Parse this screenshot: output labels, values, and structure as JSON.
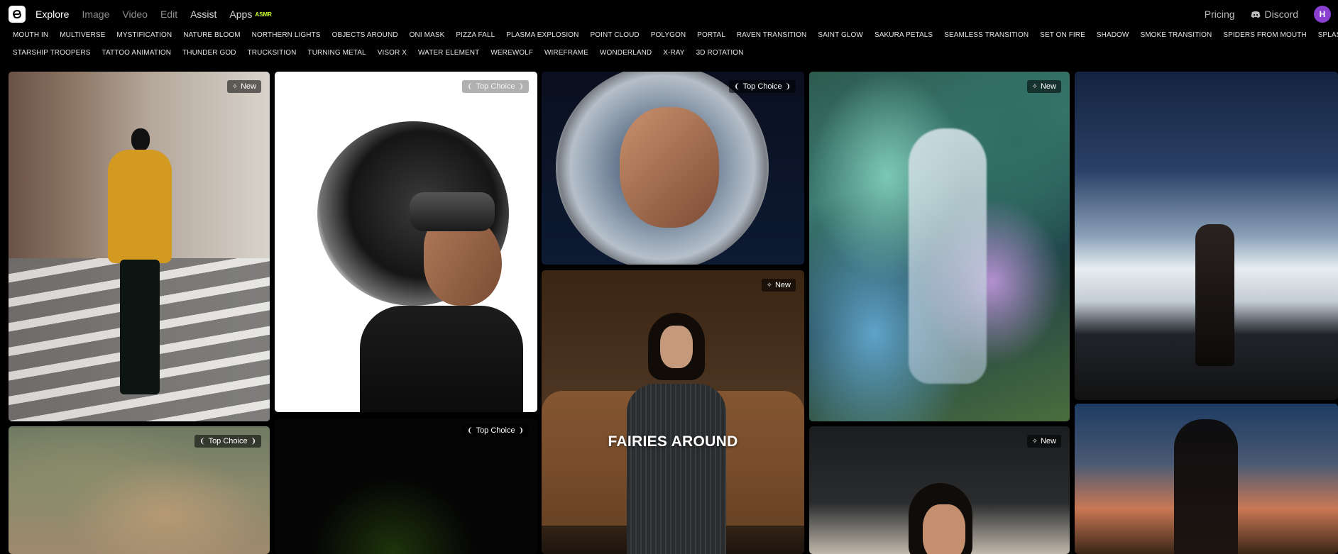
{
  "nav": {
    "links": [
      {
        "label": "Explore",
        "state": "active"
      },
      {
        "label": "Image",
        "state": "dim"
      },
      {
        "label": "Video",
        "state": "dim"
      },
      {
        "label": "Edit",
        "state": "dim"
      },
      {
        "label": "Assist",
        "state": "strong"
      },
      {
        "label": "Apps",
        "state": "strong"
      }
    ],
    "apps_badge": "ASMR",
    "pricing": "Pricing",
    "discord": "Discord",
    "avatar_initial": "H"
  },
  "tags_row1": [
    "MOUTH IN",
    "MULTIVERSE",
    "MYSTIFICATION",
    "NATURE BLOOM",
    "NORTHERN LIGHTS",
    "OBJECTS AROUND",
    "ONI MASK",
    "PIZZA FALL",
    "PLASMA EXPLOSION",
    "POINT CLOUD",
    "POLYGON",
    "PORTAL",
    "RAVEN TRANSITION",
    "SAINT GLOW",
    "SAKURA PETALS",
    "SEAMLESS TRANSITION",
    "SET ON FIRE",
    "SHADOW",
    "SMOKE TRANSITION",
    "SPIDERS FROM MOUTH",
    "SPLASH TRANSITION"
  ],
  "tags_row2": [
    "STARSHIP TROOPERS",
    "TATTOO ANIMATION",
    "THUNDER GOD",
    "TRUCKSITION",
    "TURNING METAL",
    "VISOR X",
    "WATER ELEMENT",
    "WEREWOLF",
    "WIREFRAME",
    "WONDERLAND",
    "X-RAY",
    "3D ROTATION"
  ],
  "cards": {
    "street": {
      "badge": "New"
    },
    "smoke": {
      "badge": "Top Choice"
    },
    "dark": {
      "badge": "Top Choice"
    },
    "astro": {
      "badge": "Top Choice"
    },
    "fairies": {
      "badge": "New",
      "caption": "FAIRIES AROUND"
    },
    "fluid": {
      "badge": "New"
    },
    "car": {
      "badge": "New"
    },
    "hills": {
      "badge": "Top Choice"
    }
  },
  "colors": {
    "accent_badge": "#c8ff2e",
    "avatar": "#8b3fd1",
    "background": "#000000"
  }
}
